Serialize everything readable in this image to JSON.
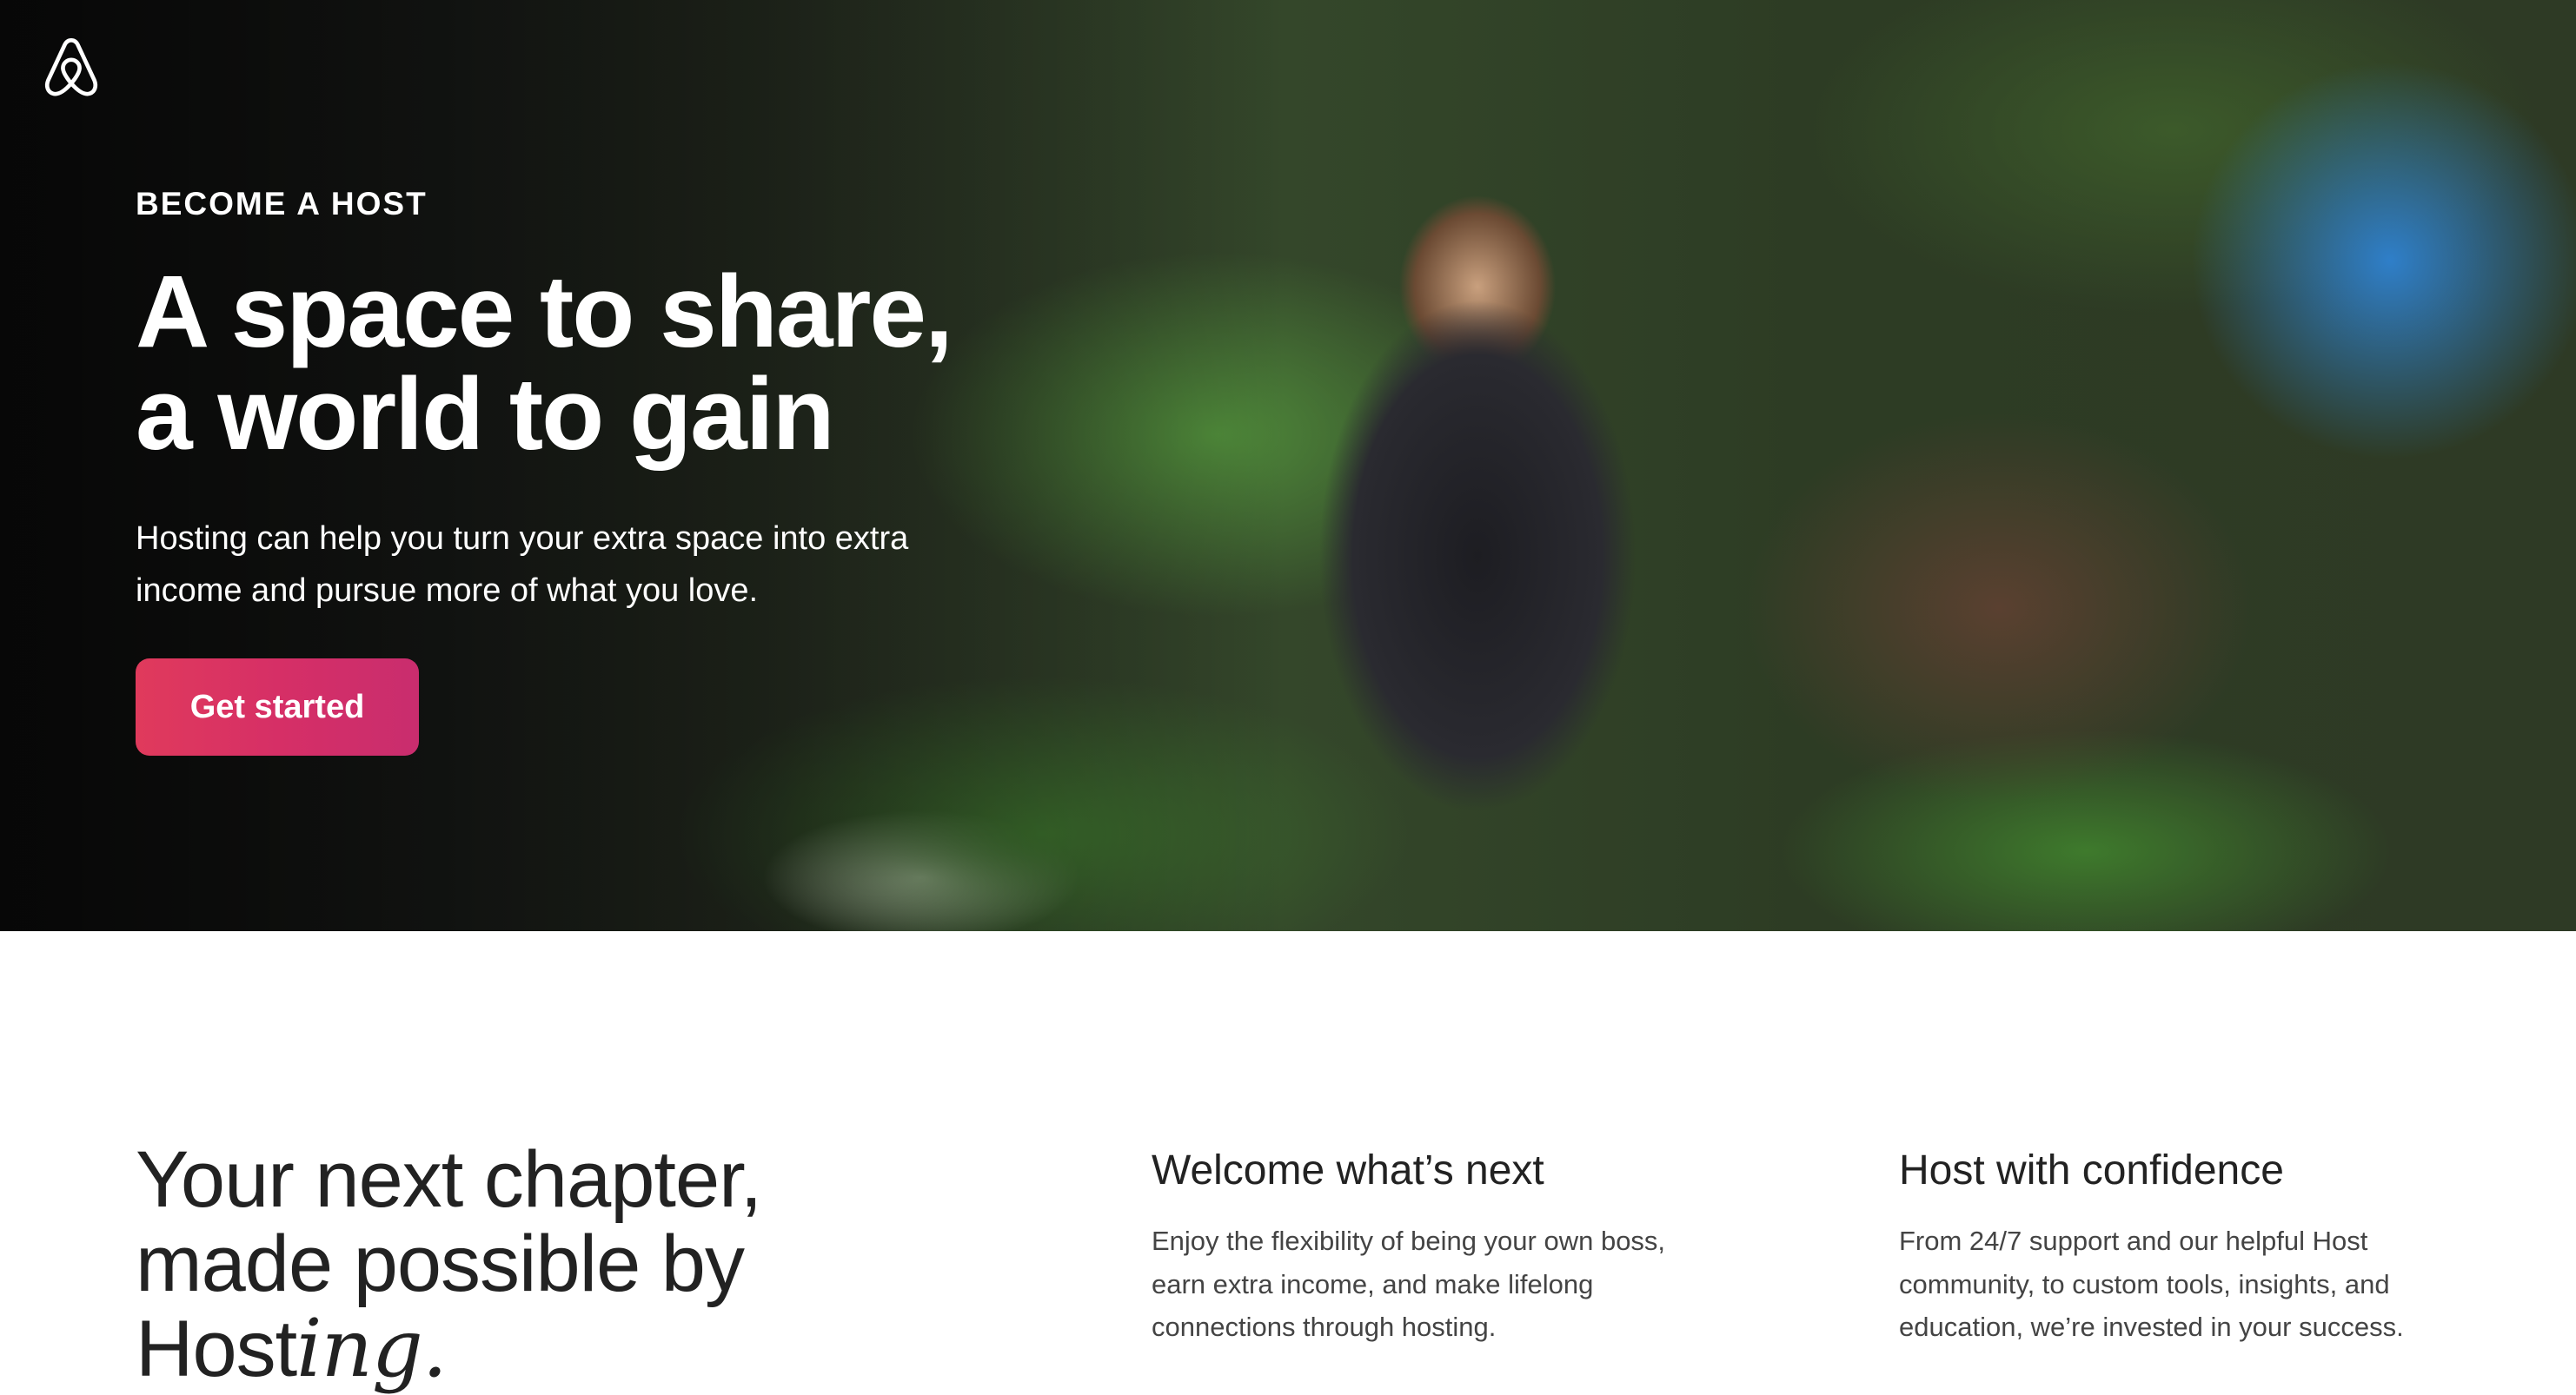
{
  "brand": {
    "logo_icon": "airbnb-belo-icon",
    "accent": "#E03A5C"
  },
  "hero": {
    "eyebrow": "BECOME A HOST",
    "headline_line1": "A space to share,",
    "headline_line2": "a world to gain",
    "subtitle": "Hosting can help you turn your extra space into extra income and pursue more of what you love.",
    "cta_label": "Get started"
  },
  "intro": {
    "title_part1": "Your next chapter,",
    "title_part2": "made possible by",
    "title_part3": "Host",
    "title_part3_italic": "ing."
  },
  "features": [
    {
      "title": "Welcome what’s next",
      "body": "Enjoy the flexibility of being your own boss, earn extra income, and make lifelong connections through hosting."
    },
    {
      "title": "Host with confidence",
      "body": "From 24/7 support and our helpful Host community, to custom tools, insights, and education, we’re invested in your success."
    }
  ]
}
